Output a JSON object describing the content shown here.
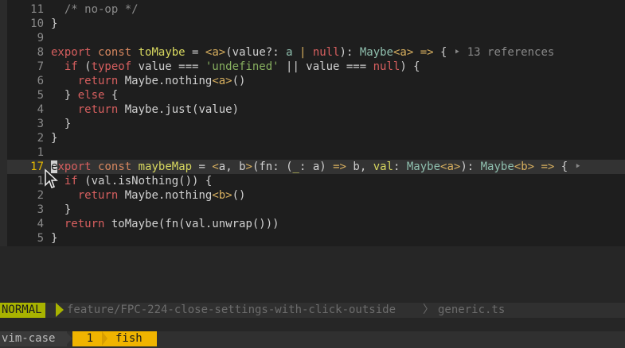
{
  "editor": {
    "lines": [
      {
        "num": "11",
        "tokens": [
          {
            "c": "t-cmt",
            "t": "  /* no-op */"
          }
        ]
      },
      {
        "num": "10",
        "tokens": [
          {
            "c": "t-pl",
            "t": "}"
          }
        ]
      },
      {
        "num": "9",
        "tokens": []
      },
      {
        "num": "8",
        "tokens": [
          {
            "c": "t-kw",
            "t": "export"
          },
          {
            "c": "t-pl",
            "t": " "
          },
          {
            "c": "t-kw2",
            "t": "const"
          },
          {
            "c": "t-pl",
            "t": " "
          },
          {
            "c": "t-fn",
            "t": "toMaybe"
          },
          {
            "c": "t-pl",
            "t": " = "
          },
          {
            "c": "t-op",
            "t": "<a>"
          },
          {
            "c": "t-pl",
            "t": "(value?: "
          },
          {
            "c": "t-type",
            "t": "a"
          },
          {
            "c": "t-pl",
            "t": " "
          },
          {
            "c": "t-op",
            "t": "|"
          },
          {
            "c": "t-pl",
            "t": " "
          },
          {
            "c": "t-kw",
            "t": "null"
          },
          {
            "c": "t-pl",
            "t": "): "
          },
          {
            "c": "t-type",
            "t": "Maybe"
          },
          {
            "c": "t-op",
            "t": "<a>"
          },
          {
            "c": "t-pl",
            "t": " "
          },
          {
            "c": "t-op",
            "t": "=>"
          },
          {
            "c": "t-pl",
            "t": " { "
          },
          {
            "c": "t-vt",
            "t": "‣ 13 references"
          }
        ]
      },
      {
        "num": "7",
        "tokens": [
          {
            "c": "t-pl",
            "t": "  "
          },
          {
            "c": "t-kw",
            "t": "if"
          },
          {
            "c": "t-pl",
            "t": " ("
          },
          {
            "c": "t-kw",
            "t": "typeof"
          },
          {
            "c": "t-pl",
            "t": " value === "
          },
          {
            "c": "t-str",
            "t": "'undefined'"
          },
          {
            "c": "t-pl",
            "t": " || value === "
          },
          {
            "c": "t-kw",
            "t": "null"
          },
          {
            "c": "t-pl",
            "t": ") {"
          }
        ]
      },
      {
        "num": "6",
        "tokens": [
          {
            "c": "t-pl",
            "t": "    "
          },
          {
            "c": "t-kw",
            "t": "return"
          },
          {
            "c": "t-pl",
            "t": " Maybe.nothing"
          },
          {
            "c": "t-op",
            "t": "<a>"
          },
          {
            "c": "t-pl",
            "t": "()"
          }
        ]
      },
      {
        "num": "5",
        "tokens": [
          {
            "c": "t-pl",
            "t": "  } "
          },
          {
            "c": "t-kw",
            "t": "else"
          },
          {
            "c": "t-pl",
            "t": " {"
          }
        ]
      },
      {
        "num": "4",
        "tokens": [
          {
            "c": "t-pl",
            "t": "    "
          },
          {
            "c": "t-kw",
            "t": "return"
          },
          {
            "c": "t-pl",
            "t": " Maybe.just(value)"
          }
        ]
      },
      {
        "num": "3",
        "tokens": [
          {
            "c": "t-pl",
            "t": "  }"
          }
        ]
      },
      {
        "num": "2",
        "tokens": [
          {
            "c": "t-pl",
            "t": "}"
          }
        ]
      },
      {
        "num": "1",
        "tokens": []
      },
      {
        "num": "17",
        "current": true,
        "tokens": [
          {
            "c": "cursor-block",
            "t": "e"
          },
          {
            "c": "t-kw",
            "t": "xport"
          },
          {
            "c": "t-pl",
            "t": " "
          },
          {
            "c": "t-kw2",
            "t": "const"
          },
          {
            "c": "t-pl",
            "t": " "
          },
          {
            "c": "t-fn",
            "t": "maybeMap"
          },
          {
            "c": "t-pl",
            "t": " = "
          },
          {
            "c": "t-op",
            "t": "<"
          },
          {
            "c": "t-pl",
            "t": "a, b"
          },
          {
            "c": "t-op",
            "t": ">"
          },
          {
            "c": "t-pl",
            "t": "(fn: ("
          },
          {
            "c": "t-fn",
            "t": "_"
          },
          {
            "c": "t-pl",
            "t": ": a) "
          },
          {
            "c": "t-op",
            "t": "=>"
          },
          {
            "c": "t-pl",
            "t": " b, "
          },
          {
            "c": "t-fn",
            "t": "val"
          },
          {
            "c": "t-pl",
            "t": ": "
          },
          {
            "c": "t-type",
            "t": "Maybe"
          },
          {
            "c": "t-op",
            "t": "<a>"
          },
          {
            "c": "t-pl",
            "t": "): "
          },
          {
            "c": "t-type",
            "t": "Maybe"
          },
          {
            "c": "t-op",
            "t": "<b>"
          },
          {
            "c": "t-pl",
            "t": " "
          },
          {
            "c": "t-op",
            "t": "=>"
          },
          {
            "c": "t-pl",
            "t": " { "
          },
          {
            "c": "t-vt",
            "t": "‣"
          }
        ]
      },
      {
        "num": "1",
        "tokens": [
          {
            "c": "t-pl",
            "t": "  "
          },
          {
            "c": "t-kw",
            "t": "if"
          },
          {
            "c": "t-pl",
            "t": " (val.isNothing()) {"
          }
        ]
      },
      {
        "num": "2",
        "tokens": [
          {
            "c": "t-pl",
            "t": "    "
          },
          {
            "c": "t-kw",
            "t": "return"
          },
          {
            "c": "t-pl",
            "t": " Maybe.nothing"
          },
          {
            "c": "t-op",
            "t": "<b>"
          },
          {
            "c": "t-pl",
            "t": "()"
          }
        ]
      },
      {
        "num": "3",
        "tokens": [
          {
            "c": "t-pl",
            "t": "  }"
          }
        ]
      },
      {
        "num": "4",
        "tokens": [
          {
            "c": "t-pl",
            "t": "  "
          },
          {
            "c": "t-kw",
            "t": "return"
          },
          {
            "c": "t-pl",
            "t": " toMaybe(fn(val.unwrap()))"
          }
        ]
      },
      {
        "num": "5",
        "tokens": [
          {
            "c": "t-pl",
            "t": "}"
          }
        ]
      }
    ]
  },
  "statusline": {
    "mode": "NORMAL",
    "branch": "feature/FPC-224-close-settings-with-click-outside",
    "separator": "〉",
    "file": "generic.ts"
  },
  "tmux": {
    "session": "vim-case",
    "window_index": "1",
    "window_name": "fish"
  },
  "colors": {
    "mode_bg": "#a8b300",
    "active_window_bg": "#f0b400",
    "cursor_line_number": "#e6b800"
  }
}
